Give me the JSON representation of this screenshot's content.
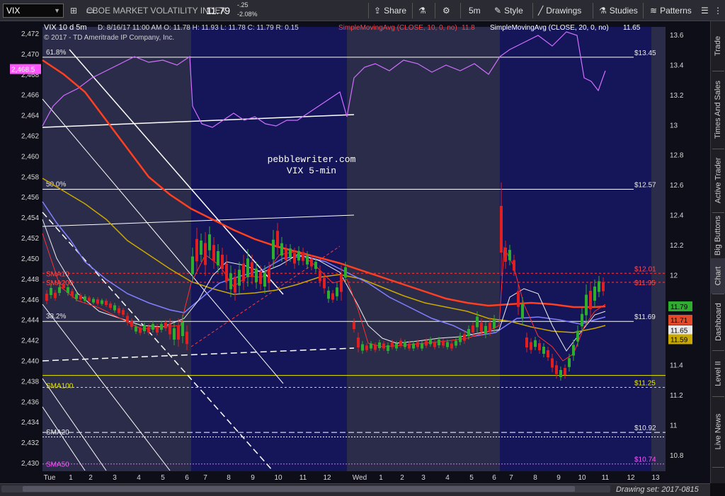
{
  "toolbar": {
    "symbol": "VIX",
    "description": "CBOE MARKET VOLATILITY INDEX",
    "last": "11.79",
    "change": "-.25",
    "change_pct": "-2.08%",
    "share": "Share",
    "timeframe": "5m",
    "style": "Style",
    "drawings": "Drawings",
    "studies": "Studies",
    "patterns": "Patterns"
  },
  "header": {
    "symbol_label": "VIX 10 d 5m",
    "ohlc": "D: 8/16/17 11:00 AM   O: 11.78   H: 11.93   L: 11.78   C: 11.79   R: 0.15",
    "sma10": "SimpleMovingAvg (CLOSE, 10, 0, no)",
    "sma10_val": "11.8",
    "sma20": "SimpleMovingAvg (CLOSE, 20, 0, no)",
    "sma20_val": "11.65",
    "copyright": "© 2017 - TD Ameritrade IP Company, Inc."
  },
  "annotation": {
    "line1": "pebblewriter.com",
    "line2": "VIX 5-min"
  },
  "left_axis": {
    "ticks": [
      "2,472",
      "2,470",
      "2,468",
      "2,466",
      "2,464",
      "2,462",
      "2,460",
      "2,458",
      "2,456",
      "2,454",
      "2,452",
      "2,450",
      "2,448",
      "2,446",
      "2,444",
      "2,442",
      "2,440",
      "2,438",
      "2,436",
      "2,434",
      "2,432",
      "2,430"
    ],
    "marker": "2,468.5"
  },
  "right_axis": {
    "ticks": [
      "13.6",
      "13.4",
      "13.2",
      "13",
      "12.8",
      "12.6",
      "12.4",
      "12.2",
      "12",
      "11.8",
      "11.6",
      "11.4",
      "11.2",
      "11",
      "10.8"
    ],
    "badges": [
      {
        "label": "11.79",
        "color": "#2eae2e"
      },
      {
        "label": "11.71",
        "color": "#e24a2a"
      },
      {
        "label": "11.65",
        "color": "#e8e8e8"
      },
      {
        "label": "11.59",
        "color": "#c9a800"
      }
    ]
  },
  "level_labels": [
    {
      "text": "$13.45",
      "color": "#e8e8e8"
    },
    {
      "text": "$12.57",
      "color": "#e8e8e8"
    },
    {
      "text": "$12.01",
      "color": "#ff4a4a"
    },
    {
      "text": "$11.95",
      "color": "#ff4a4a"
    },
    {
      "text": "$11.69",
      "color": "#e8e8e8"
    },
    {
      "text": "$11.25",
      "color": "#e8e800"
    },
    {
      "text": "$10.92",
      "color": "#e8e8e8"
    },
    {
      "text": "$10.74",
      "color": "#ff55ff"
    }
  ],
  "fib_labels": [
    "61.8%",
    "50.0%",
    "38.2%"
  ],
  "sma_labels": [
    {
      "text": "SMA10",
      "color": "#ff4a4a"
    },
    {
      "text": "SMA200",
      "color": "#ff4a4a"
    },
    {
      "text": "SMA100",
      "color": "#e8e800"
    },
    {
      "text": "SMA20",
      "color": "#e8e8e8"
    },
    {
      "text": "SMA50",
      "color": "#ff55ff"
    }
  ],
  "x_axis": {
    "labels": [
      "Tue",
      "1",
      "2",
      "3",
      "4",
      "5",
      "6",
      "7",
      "8",
      "9",
      "10",
      "11",
      "12",
      "Wed",
      "1",
      "2",
      "3",
      "4",
      "5",
      "6",
      "7",
      "8",
      "9",
      "10",
      "11",
      "12",
      "13"
    ]
  },
  "side_tabs": [
    "Trade",
    "Times And Sales",
    "Active Trader",
    "Big Buttons",
    "Chart",
    "Dashboard",
    "Level II",
    "Live News"
  ],
  "status": {
    "drawing_set": "Drawing set: 2017-0815"
  }
}
